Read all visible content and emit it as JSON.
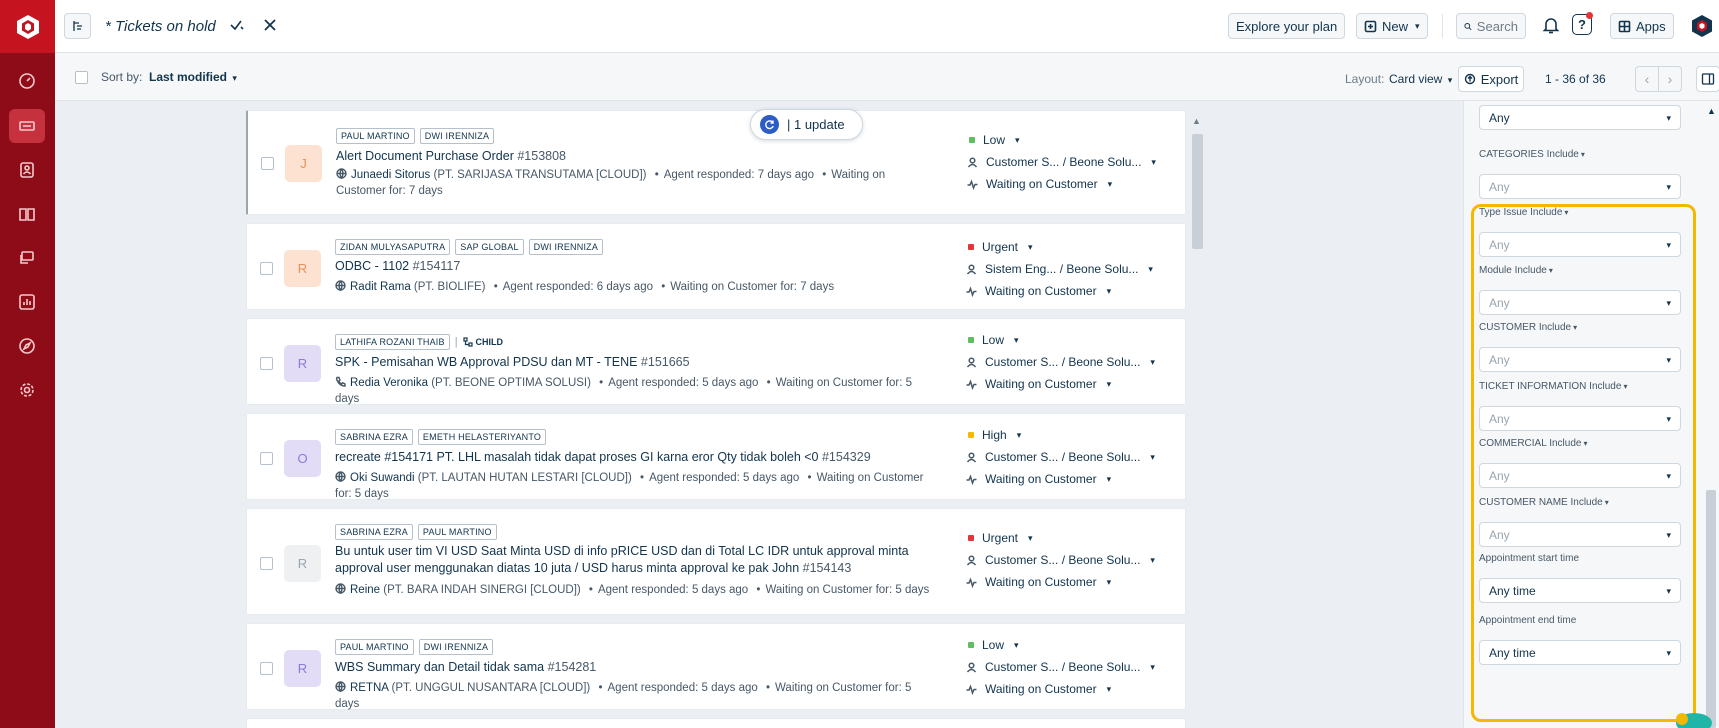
{
  "colors": {
    "brand": "#c5141f",
    "rail": "#8e0c18",
    "highlight": "#f5b800",
    "accent": "#2c5cc5"
  },
  "topbar": {
    "view_title": "* Tickets on hold",
    "explore": "Explore your plan",
    "new": "New",
    "search": "Search",
    "apps": "Apps"
  },
  "subbar": {
    "sort_label": "Sort by:",
    "sort_value": "Last modified",
    "layout_label": "Layout:",
    "layout_value": "Card view",
    "export": "Export",
    "pager": "1 - 36 of 36"
  },
  "update_pill": {
    "text": "| 1 update"
  },
  "tickets": [
    {
      "avatar": "J",
      "avatar_bg": "#fde2d1",
      "avatar_fg": "#e8915c",
      "tags": [
        "PAUL MARTINO",
        "DWI IRENNIZA"
      ],
      "child": "",
      "subject": "Alert Document Purchase Order",
      "number": "#153808",
      "requester": "Junaedi Sitorus",
      "company": "(PT. SARIJASA TRANSUTAMA [CLOUD])",
      "responded": "Agent responded: 7 days ago",
      "waiting": "Waiting on Customer for: 7 days",
      "source": "globe",
      "priority": "Low",
      "priority_color": "#5fbe5f",
      "group": "Customer S... / Beone Solu...",
      "status": "Waiting on Customer"
    },
    {
      "avatar": "R",
      "avatar_bg": "#fde2d1",
      "avatar_fg": "#e8915c",
      "tags": [
        "ZIDAN MULYASAPUTRA",
        "SAP GLOBAL",
        "DWI IRENNIZA"
      ],
      "child": "",
      "subject": "ODBC - 1102",
      "number": "#154117",
      "requester": "Radit Rama",
      "company": "(PT. BIOLIFE)",
      "responded": "Agent responded: 6 days ago",
      "waiting": "Waiting on Customer for: 7 days",
      "source": "globe",
      "priority": "Urgent",
      "priority_color": "#e43538",
      "group": "Sistem Eng... / Beone Solu...",
      "status": "Waiting on Customer"
    },
    {
      "avatar": "R",
      "avatar_bg": "#e2dcf7",
      "avatar_fg": "#8b7bd8",
      "tags": [
        "LATHIFA ROZANI THAIB"
      ],
      "child": "CHILD",
      "subject": "SPK - Pemisahan WB Approval PDSU dan MT - TENE",
      "number": "#151665",
      "requester": "Redia Veronika",
      "company": "(PT. BEONE OPTIMA SOLUSI)",
      "responded": "Agent responded: 5 days ago",
      "waiting": "Waiting on Customer for: 5 days",
      "source": "phone",
      "priority": "Low",
      "priority_color": "#5fbe5f",
      "group": "Customer S... / Beone Solu...",
      "status": "Waiting on Customer"
    },
    {
      "avatar": "O",
      "avatar_bg": "#e2dcf7",
      "avatar_fg": "#8b7bd8",
      "tags": [
        "SABRINA EZRA",
        "EMETH HELASTERIYANTO"
      ],
      "child": "",
      "subject": "recreate #154171 PT. LHL masalah tidak dapat proses GI karna eror Qty tidak boleh <0",
      "number": "#154329",
      "requester": "Oki Suwandi",
      "company": "(PT. LAUTAN HUTAN LESTARI [CLOUD])",
      "responded": "Agent responded: 5 days ago",
      "waiting": "Waiting on Customer for: 5 days",
      "source": "globe",
      "priority": "High",
      "priority_color": "#f5b800",
      "group": "Customer S... / Beone Solu...",
      "status": "Waiting on Customer"
    },
    {
      "avatar": "R",
      "avatar_bg": "#eef0f2",
      "avatar_fg": "#9aa5b0",
      "tags": [
        "SABRINA EZRA",
        "PAUL MARTINO"
      ],
      "child": "",
      "subject": "Bu untuk user tim VI USD Saat Minta USD di info pRICE USD dan di Total LC IDR untuk approval minta approval user menggunakan diatas 10 juta / USD harus minta approval ke pak John",
      "number": "#154143",
      "requester": "Reine",
      "company": "(PT. BARA INDAH SINERGI [CLOUD])",
      "responded": "Agent responded: 5 days ago",
      "waiting": "Waiting on Customer for: 5 days",
      "source": "globe",
      "priority": "Urgent",
      "priority_color": "#e43538",
      "group": "Customer S... / Beone Solu...",
      "status": "Waiting on Customer"
    },
    {
      "avatar": "R",
      "avatar_bg": "#e2dcf7",
      "avatar_fg": "#8b7bd8",
      "tags": [
        "PAUL MARTINO",
        "DWI IRENNIZA"
      ],
      "child": "",
      "subject": "WBS Summary dan Detail tidak sama",
      "number": "#154281",
      "requester": "RETNA",
      "company": "(PT. UNGGUL NUSANTARA [CLOUD])",
      "responded": "Agent responded: 5 days ago",
      "waiting": "Waiting on Customer for: 5 days",
      "source": "globe",
      "priority": "Low",
      "priority_color": "#5fbe5f",
      "group": "Customer S... / Beone Solu...",
      "status": "Waiting on Customer"
    }
  ],
  "filters": {
    "top_value": "Any",
    "fields": [
      {
        "label": "CATEGORIES Include",
        "value": "Any"
      },
      {
        "label": "Type Issue Include",
        "value": "Any"
      },
      {
        "label": "Module Include",
        "value": "Any"
      },
      {
        "label": "CUSTOMER Include",
        "value": "Any"
      },
      {
        "label": "TICKET INFORMATION Include",
        "value": "Any"
      },
      {
        "label": "COMMERCIAL Include",
        "value": "Any"
      },
      {
        "label": "CUSTOMER NAME Include",
        "value": "Any"
      },
      {
        "label": "Appointment start time",
        "value": "Any time"
      },
      {
        "label": "Appointment end time",
        "value": "Any time"
      }
    ]
  }
}
